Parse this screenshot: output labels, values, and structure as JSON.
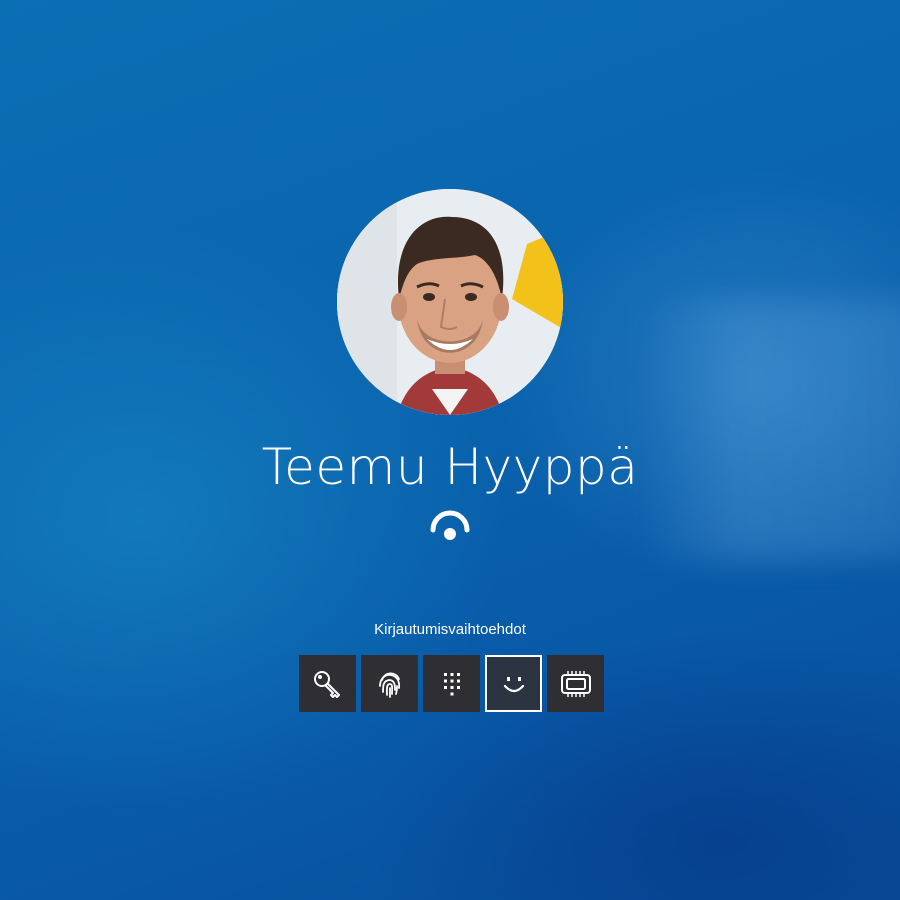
{
  "user": {
    "name": "Teemu Hyyppä"
  },
  "signin": {
    "options_label": "Kirjautumisvaihtoehdot",
    "status_icon": "face-recognition-icon",
    "options": [
      {
        "icon": "key-icon",
        "selected": false
      },
      {
        "icon": "fingerprint-icon",
        "selected": false
      },
      {
        "icon": "pin-keypad-icon",
        "selected": false
      },
      {
        "icon": "face-icon",
        "selected": true
      },
      {
        "icon": "security-key-icon",
        "selected": false
      }
    ]
  },
  "colors": {
    "background": "#0a63a8",
    "tile": "#2f2f33",
    "text": "#ffffff"
  }
}
